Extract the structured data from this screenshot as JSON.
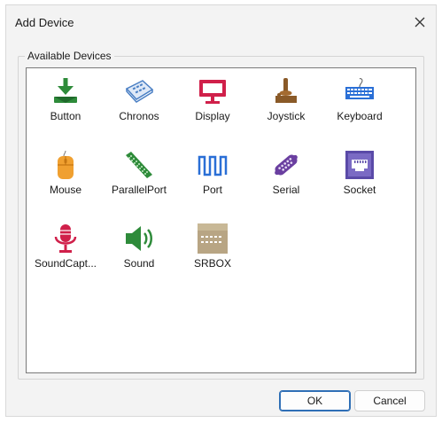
{
  "dialog": {
    "title": "Add Device",
    "close_glyph": "✕"
  },
  "group": {
    "label": "Available Devices"
  },
  "devices": [
    {
      "label": "Button",
      "icon": "button-icon"
    },
    {
      "label": "Chronos",
      "icon": "chronos-icon"
    },
    {
      "label": "Display",
      "icon": "display-icon"
    },
    {
      "label": "Joystick",
      "icon": "joystick-icon"
    },
    {
      "label": "Keyboard",
      "icon": "keyboard-icon"
    },
    {
      "label": "Mouse",
      "icon": "mouse-icon"
    },
    {
      "label": "ParallelPort",
      "icon": "parallel-port-icon"
    },
    {
      "label": "Port",
      "icon": "port-icon"
    },
    {
      "label": "Serial",
      "icon": "serial-icon"
    },
    {
      "label": "Socket",
      "icon": "socket-icon"
    },
    {
      "label": "SoundCapt...",
      "icon": "sound-capture-icon"
    },
    {
      "label": "Sound",
      "icon": "sound-icon"
    },
    {
      "label": "SRBOX",
      "icon": "srbox-icon"
    }
  ],
  "buttons": {
    "ok": "OK",
    "cancel": "Cancel"
  },
  "colors": {
    "green": "#2e8b3a",
    "red": "#d0204a",
    "brown": "#8a5a28",
    "blue": "#2a6fd6",
    "purple": "#6a3fa0",
    "orange": "#f0a030",
    "tan": "#b8a584"
  }
}
